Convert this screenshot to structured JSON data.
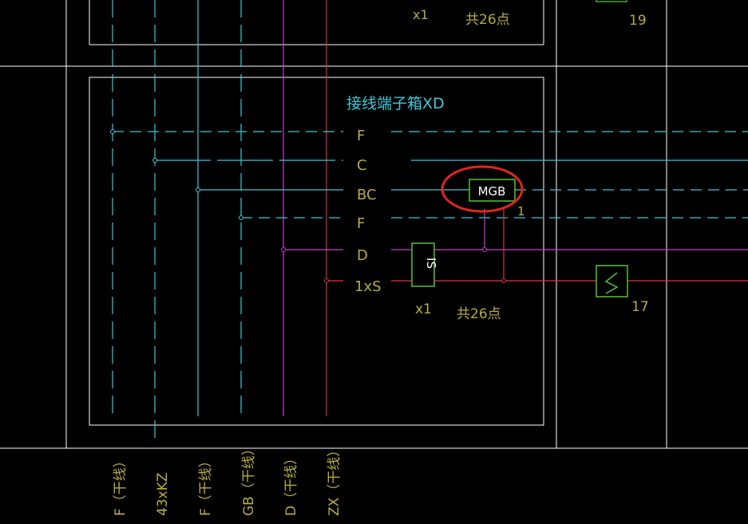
{
  "terminal_box": {
    "title": "接线端子箱XD",
    "rows": [
      "F",
      "C",
      "BC",
      "F",
      "D",
      "1xS"
    ]
  },
  "upper_box": {
    "multiplier": "x1",
    "point_count": "共26点",
    "number": "19"
  },
  "devices": {
    "mgb_label": "MGB",
    "mgb_number": "1",
    "is_label": "IS",
    "is_multiplier": "x1",
    "point_count": "共26点",
    "switch_number": "17"
  },
  "bottom_labels": [
    "F（干线）",
    "43xKZ",
    "F（干线）",
    "GB（干线）",
    "D（干线）",
    "ZX（干线）"
  ],
  "colors": {
    "background": "#000000",
    "frame": "#ffffff",
    "cyan_wire": "#3ec7d8",
    "magenta_wire": "#c63fd0",
    "red_wire": "#d8343a",
    "yellow_text": "#b7ad3d",
    "green_device": "#55c234",
    "highlight": "#e0261e"
  }
}
